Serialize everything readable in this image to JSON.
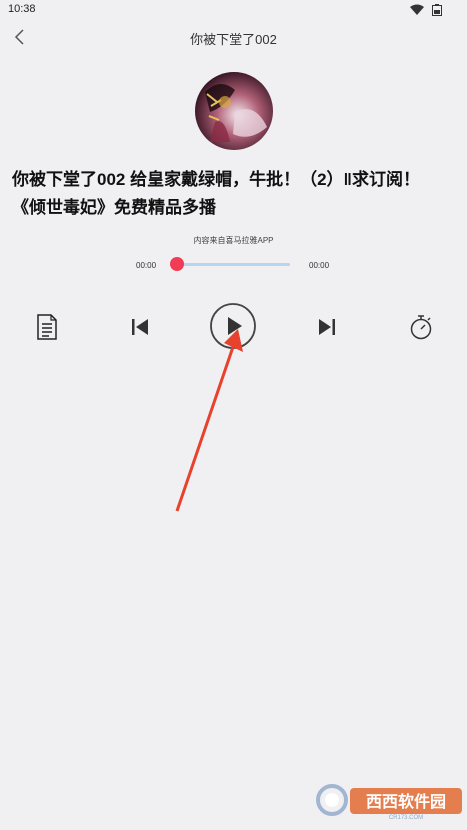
{
  "status": {
    "time": "10:38"
  },
  "header": {
    "title": "你被下堂了002"
  },
  "track": {
    "title": "你被下堂了002 给皇家戴绿帽，牛批！（2）‖求订阅！《倾世毒妃》免费精品多播",
    "source": "内容来自喜马拉雅APP",
    "current_time": "00:00",
    "duration": "00:00",
    "progress": 0.05
  },
  "controls": {
    "icons": [
      "playlist-icon",
      "previous-icon",
      "play-icon",
      "next-icon",
      "timer-icon"
    ]
  },
  "colors": {
    "accent": "#f23b54",
    "track": "#b9d4ee",
    "arrow": "#e8412d"
  },
  "watermark": {
    "brand": "西西软件园",
    "site": "CR173.COM"
  }
}
